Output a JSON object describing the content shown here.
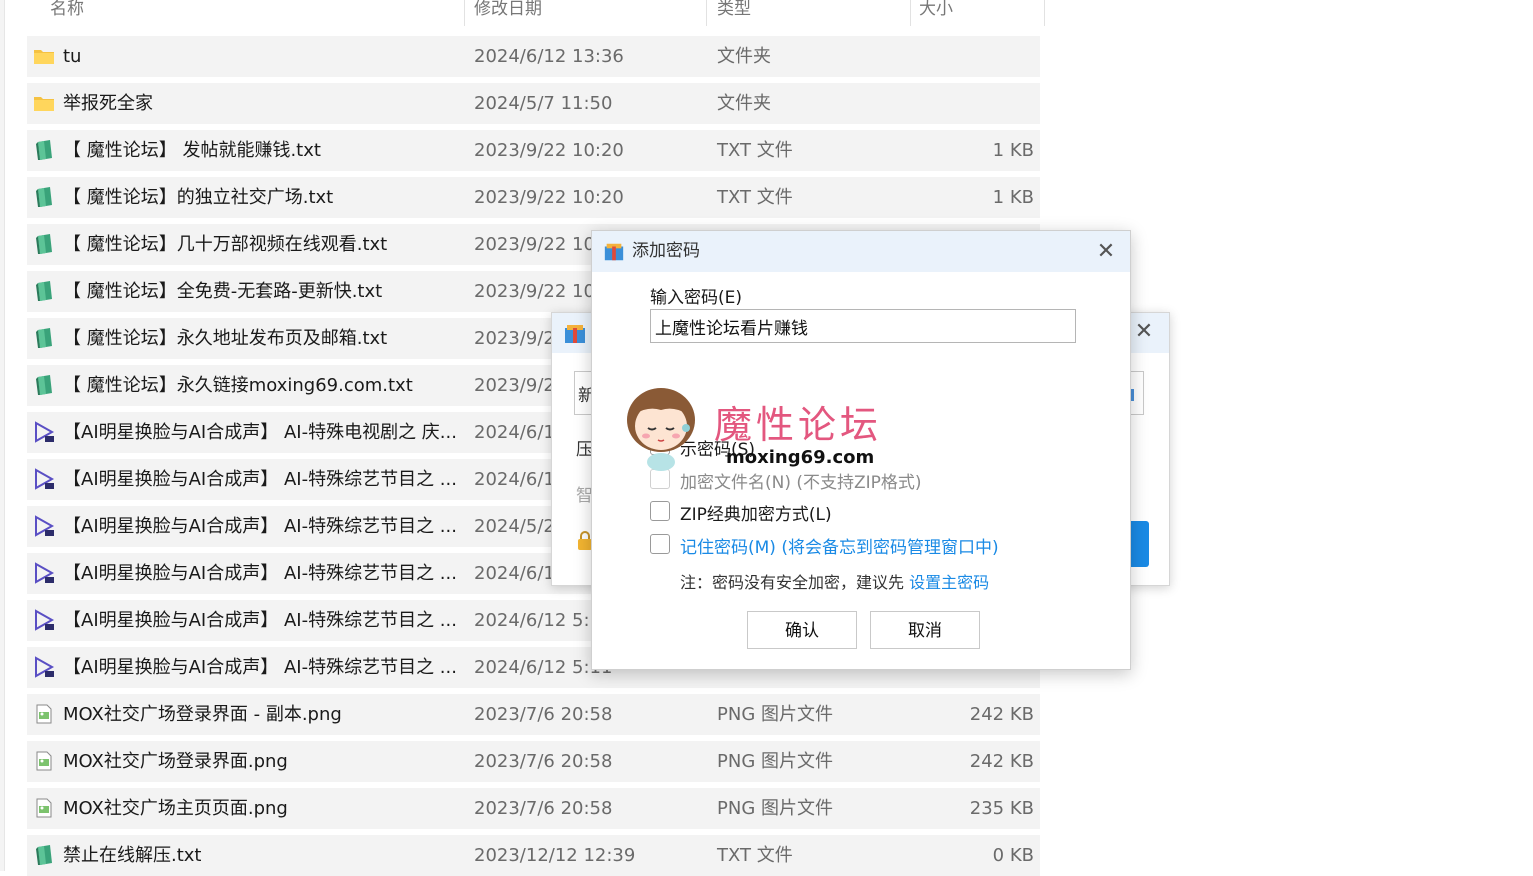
{
  "columns": {
    "name": "名称",
    "date": "修改日期",
    "type": "类型",
    "size": "大小"
  },
  "files": [
    {
      "icon": "folder-icon",
      "name": "tu",
      "date": "2024/6/12 13:36",
      "type": "文件夹",
      "size": ""
    },
    {
      "icon": "folder-icon",
      "name": "举报死全家",
      "date": "2024/5/7 11:50",
      "type": "文件夹",
      "size": ""
    },
    {
      "icon": "txt-file-icon",
      "name": "【 魔性论坛】 发帖就能赚钱.txt",
      "date": "2023/9/22 10:20",
      "type": "TXT 文件",
      "size": "1 KB"
    },
    {
      "icon": "txt-file-icon",
      "name": "【 魔性论坛】的独立社交广场.txt",
      "date": "2023/9/22 10:20",
      "type": "TXT 文件",
      "size": "1 KB"
    },
    {
      "icon": "txt-file-icon",
      "name": "【 魔性论坛】几十万部视频在线观看.txt",
      "date": "2023/9/22 10",
      "type": "",
      "size": ""
    },
    {
      "icon": "txt-file-icon",
      "name": "【 魔性论坛】全免费-无套路-更新快.txt",
      "date": "2023/9/22 10",
      "type": "",
      "size": ""
    },
    {
      "icon": "txt-file-icon",
      "name": "【 魔性论坛】永久地址发布页及邮箱.txt",
      "date": "2023/9/2",
      "type": "",
      "size": ""
    },
    {
      "icon": "txt-file-icon",
      "name": "【 魔性论坛】永久链接moxing69.com.txt",
      "date": "2023/9/2",
      "type": "",
      "size": ""
    },
    {
      "icon": "video-file-icon",
      "name": "【AI明星换脸与AI合成声】 AI-特殊电视剧之 庆...",
      "date": "2024/6/1",
      "type": "",
      "size": ""
    },
    {
      "icon": "video-file-icon",
      "name": "【AI明星换脸与AI合成声】 AI-特殊综艺节目之 ...",
      "date": "2024/6/1",
      "type": "",
      "size": ""
    },
    {
      "icon": "video-file-icon",
      "name": "【AI明星换脸与AI合成声】 AI-特殊综艺节目之 ...",
      "date": "2024/5/2",
      "type": "",
      "size": ""
    },
    {
      "icon": "video-file-icon",
      "name": "【AI明星换脸与AI合成声】 AI-特殊综艺节目之 ...",
      "date": "2024/6/1",
      "type": "",
      "size": ""
    },
    {
      "icon": "video-file-icon",
      "name": "【AI明星换脸与AI合成声】 AI-特殊综艺节目之 ...",
      "date": "2024/6/12 5:",
      "type": "",
      "size": ""
    },
    {
      "icon": "video-file-icon",
      "name": "【AI明星换脸与AI合成声】 AI-特殊综艺节目之 ...",
      "date": "2024/6/12 5:11",
      "type": "",
      "size": ""
    },
    {
      "icon": "png-file-icon",
      "name": "MOX社交广场登录界面 - 副本.png",
      "date": "2023/7/6 20:58",
      "type": "PNG 图片文件",
      "size": "242 KB"
    },
    {
      "icon": "png-file-icon",
      "name": "MOX社交广场登录界面.png",
      "date": "2023/7/6 20:58",
      "type": "PNG 图片文件",
      "size": "242 KB"
    },
    {
      "icon": "png-file-icon",
      "name": "MOX社交广场主页页面.png",
      "date": "2023/7/6 20:58",
      "type": "PNG 图片文件",
      "size": "235 KB"
    },
    {
      "icon": "txt-file-icon",
      "name": "禁止在线解压.txt",
      "date": "2023/12/12 12:39",
      "type": "TXT 文件",
      "size": "0 KB"
    }
  ],
  "bg_dialog": {
    "frag_1": "新",
    "frag_2": "压",
    "frag_3": "智",
    "close": "✕"
  },
  "dialog": {
    "title": "添加密码",
    "close": "✕",
    "input_label": "输入密码(E)",
    "password_value": "上魔性论坛看片赚钱",
    "show_password": "示密码(S)",
    "encrypt_filenames": "加密文件名(N) (不支持ZIP格式)",
    "zip_classic": "ZIP经典加密方式(L)",
    "remember": "记住密码(M) (将会备忘到密码管理窗口中)",
    "note_prefix": "注：密码没有安全加密，建议先 ",
    "note_link": "设置主密码",
    "ok": "确认",
    "cancel": "取消"
  },
  "watermark": {
    "logo": "魔性论坛",
    "url": "moxing69.com"
  },
  "colors": {
    "row_bg": "#f3f3f3",
    "accent_blue": "#1a8ae5",
    "watermark_pink": "#e3577f"
  }
}
